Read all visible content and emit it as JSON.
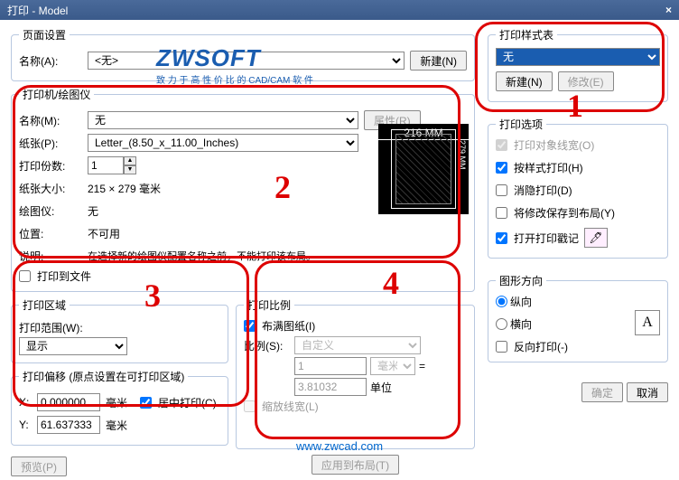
{
  "window": {
    "title": "打印 - Model",
    "close": "×"
  },
  "pageSetup": {
    "legend": "页面设置",
    "nameLabel": "名称(A):",
    "nameValue": "<无>",
    "newBtn": "新建(N)"
  },
  "printer": {
    "legend": "打印机/绘图仪",
    "nameLabel": "名称(M):",
    "nameValue": "无",
    "propsBtn": "属性(R)",
    "paperLabel": "纸张(P):",
    "paperValue": "Letter_(8.50_x_11.00_Inches)",
    "copiesLabel": "打印份数:",
    "copiesValue": "1",
    "sizeLabel": "纸张大小:",
    "sizeValue": "215 × 279  毫米",
    "plotterLabel": "绘图仪:",
    "plotterValue": "无",
    "locLabel": "位置:",
    "locValue": "不可用",
    "descLabel": "说明:",
    "descValue": "在选择新的绘图仪配置名称之前，不能打印该布局。",
    "toFile": "打印到文件",
    "previewTop": "216 MM",
    "previewSide": "279 MM"
  },
  "area": {
    "legend": "打印区域",
    "rangeLabel": "打印范围(W):",
    "rangeValue": "显示",
    "offsetLegend": "打印偏移 (原点设置在可打印区域)",
    "xLabel": "X:",
    "xValue": "0.000000",
    "xUnit": "毫米",
    "yLabel": "Y:",
    "yValue": "61.637333",
    "yUnit": "毫米",
    "center": "居中打印(C)",
    "previewBtn": "预览(P)"
  },
  "scale": {
    "legend": "打印比例",
    "fit": "布满图纸(I)",
    "ratioLabel": "比例(S):",
    "ratioValue": "自定义",
    "num": "1",
    "unit": "毫米",
    "eq": "=",
    "denom": "3.81032",
    "unitLabel": "单位",
    "scaleLw": "缩放线宽(L)",
    "applyBtn": "应用到布局(T)"
  },
  "styleTable": {
    "legend": "打印样式表",
    "value": "无",
    "newBtn": "新建(N)",
    "editBtn": "修改(E)"
  },
  "options": {
    "legend": "打印选项",
    "lw": "打印对象线宽(O)",
    "byStyle": "按样式打印(H)",
    "hide": "消隐打印(D)",
    "saveLayout": "将修改保存到布局(Y)",
    "stamp": "打开打印戳记"
  },
  "orient": {
    "legend": "图形方向",
    "portrait": "纵向",
    "landscape": "横向",
    "reverse": "反向打印(-)"
  },
  "buttons": {
    "ok": "确定",
    "cancel": "取消"
  },
  "footer": "www.zwcad.com",
  "logo": {
    "brand": "ZWSOFT",
    "tagline": "致 力 于 高 性 价 比 的 CAD/CAM 软 件"
  },
  "annotations": {
    "n1": "1",
    "n2": "2",
    "n3": "3",
    "n4": "4"
  }
}
